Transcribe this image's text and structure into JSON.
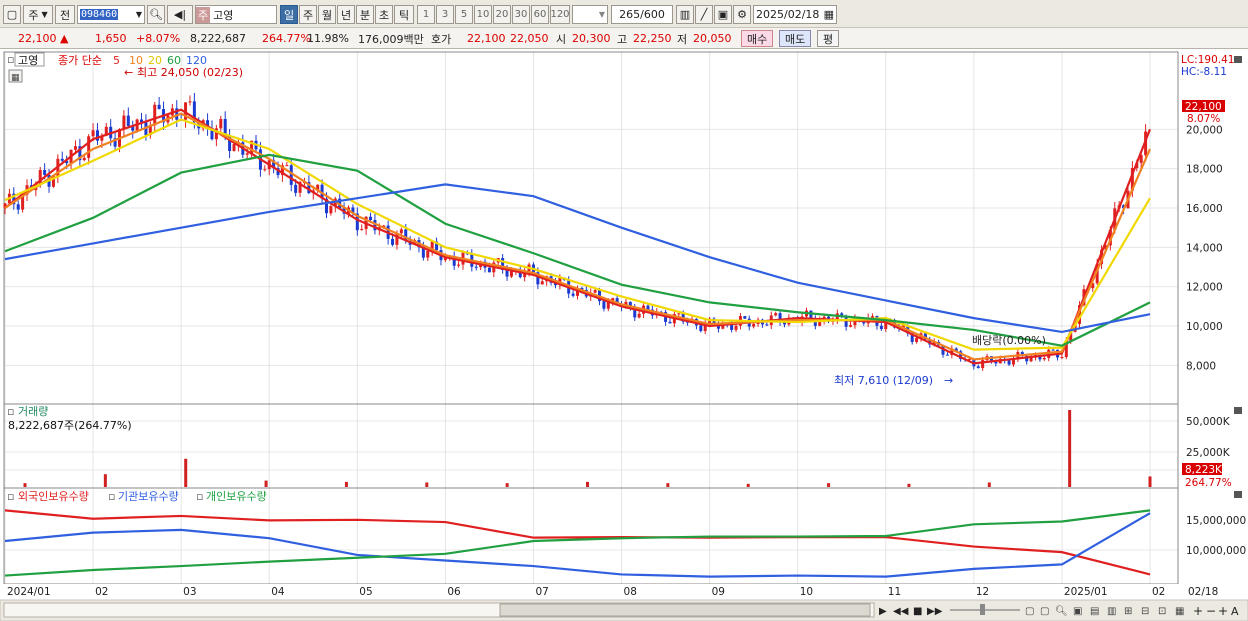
{
  "toolbar": {
    "market_label": "주",
    "prev_label": "전",
    "code": "098460",
    "stock_name": "고영",
    "name_tag": "주",
    "periods": [
      "일",
      "주",
      "월",
      "년",
      "분",
      "초",
      "틱"
    ],
    "minute_units": [
      "1",
      "3",
      "5",
      "10",
      "20",
      "30",
      "60",
      "120"
    ],
    "count": "265",
    "count_total": "/600",
    "date": "2025/02/18"
  },
  "quote": {
    "price": "22,100",
    "up_arrow": "▲",
    "change": "1,650",
    "change_pct": "+8.07%",
    "volume": "8,222,687",
    "vol_ratio": "264.77%",
    "turnover": "11.98%",
    "amount": "176,009백만",
    "hoga_label": "호가",
    "ask": "22,100",
    "bid": "22,050",
    "open_label": "시",
    "open": "20,300",
    "high_label": "고",
    "high": "22,250",
    "low_label": "저",
    "low": "20,050",
    "buy_label": "매수",
    "sell_label": "매도",
    "avg_label": "평"
  },
  "price_panel": {
    "legend": {
      "name": "고영",
      "ma_label": "종가 단순",
      "ma_periods": [
        "5",
        "10",
        "20",
        "60",
        "120"
      ],
      "ma_colors": [
        "#e02020",
        "#f08020",
        "#f0d800",
        "#20a040",
        "#3060e0"
      ]
    },
    "hi_note": "최고 24,050 (02/23)",
    "lo_note": "최저 7,610 (12/09)",
    "div_note": "배당락(0.00%)",
    "lc": "LC:190.41",
    "hc": "HC:-8.11",
    "last_price": "22,100",
    "last_pct": "8.07%",
    "axis": [
      "20,000",
      "18,000",
      "16,000",
      "14,000",
      "12,000",
      "10,000",
      "8,000"
    ]
  },
  "volume_panel": {
    "title": "거래량",
    "value": "8,222,687주(264.77%)",
    "axis": [
      "50,000K",
      "25,000K"
    ],
    "last": "8,223K",
    "last_pct": "264.77%"
  },
  "holding_panel": {
    "legend": [
      {
        "name": "외국인보유수량",
        "color": "#e02020"
      },
      {
        "name": "기관보유수량",
        "color": "#3060e0"
      },
      {
        "name": "개인보유수량",
        "color": "#20a040"
      }
    ],
    "axis": [
      "15,000,000",
      "10,000,000"
    ]
  },
  "x_axis": [
    "2024/01",
    "02",
    "03",
    "04",
    "05",
    "06",
    "07",
    "08",
    "09",
    "10",
    "11",
    "12",
    "2025/01",
    "02",
    "02/18"
  ],
  "chart_data": [
    {
      "type": "line",
      "title": "",
      "y_scale": "linear",
      "ylim": [
        6800,
        22600
      ],
      "x": [
        "2024-01",
        "2024-02",
        "2024-03",
        "2024-04",
        "2024-05",
        "2024-06",
        "2024-07",
        "2024-08",
        "2024-09",
        "2024-10",
        "2024-11",
        "2024-12",
        "2025-01",
        "2025-02"
      ],
      "series": [
        {
          "name": "5",
          "color": "#e02020",
          "values": [
            16000,
            19500,
            21000,
            18200,
            15400,
            13500,
            12600,
            11000,
            10000,
            10400,
            10200,
            8100,
            8600,
            20000
          ]
        },
        {
          "name": "10",
          "color": "#f08020",
          "values": [
            16000,
            19000,
            20800,
            18500,
            15600,
            13600,
            12700,
            11100,
            10100,
            10300,
            10300,
            8300,
            8700,
            19000
          ]
        },
        {
          "name": "20",
          "color": "#f0d800",
          "values": [
            16400,
            18400,
            20500,
            19000,
            16200,
            14000,
            12900,
            11500,
            10300,
            10200,
            10400,
            8800,
            8900,
            16500
          ]
        },
        {
          "name": "60",
          "color": "#20a040",
          "values": [
            13800,
            15500,
            17800,
            18700,
            17900,
            15200,
            13700,
            12100,
            11200,
            10700,
            10300,
            9800,
            9000,
            11200
          ]
        },
        {
          "name": "120",
          "color": "#3060e0",
          "values": [
            13400,
            14200,
            15000,
            15800,
            16500,
            17200,
            16600,
            15000,
            13500,
            12200,
            11300,
            10400,
            9700,
            10600
          ]
        }
      ]
    },
    {
      "type": "bar",
      "title": "거래량",
      "unit": "K",
      "ylim": [
        0,
        60000
      ],
      "series": [
        {
          "name": "거래량",
          "values": [
            3000,
            10000,
            22000,
            5000,
            4000,
            3500,
            3000,
            4000,
            3000,
            2500,
            3000,
            2500,
            3500,
            60000,
            8223
          ]
        }
      ]
    },
    {
      "type": "line",
      "title": "보유수량",
      "ylim": [
        5000000,
        19000000
      ],
      "x": [
        "2024-01",
        "2024-02",
        "2024-03",
        "2024-04",
        "2024-05",
        "2024-06",
        "2024-07",
        "2024-08",
        "2024-09",
        "2024-10",
        "2024-11",
        "2024-12",
        "2025-01",
        "2025-02"
      ],
      "series": [
        {
          "name": "외국인보유수량",
          "color": "#e02020",
          "values": [
            17500,
            16000,
            16500,
            15700,
            15800,
            15400,
            12600,
            12700,
            12600,
            12700,
            12700,
            11000,
            10000,
            6000
          ]
        },
        {
          "name": "기관보유수량",
          "color": "#3060e0",
          "values": [
            12000,
            13500,
            14000,
            12500,
            9500,
            8500,
            7500,
            6000,
            5600,
            5800,
            5600,
            7000,
            7800,
            17000
          ]
        },
        {
          "name": "개인보유수량",
          "color": "#20a040",
          "values": [
            5800,
            6800,
            7500,
            8300,
            9000,
            9700,
            12000,
            12500,
            12800,
            12800,
            12900,
            15000,
            15500,
            17500
          ]
        }
      ]
    }
  ]
}
